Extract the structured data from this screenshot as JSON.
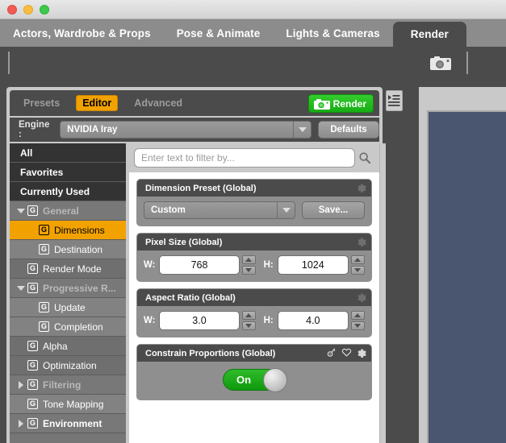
{
  "window": {
    "traffic_lights": [
      "close",
      "minimize",
      "zoom"
    ]
  },
  "main_tabs": [
    {
      "label": "Actors, Wardrobe & Props",
      "active": false
    },
    {
      "label": "Pose & Animate",
      "active": false
    },
    {
      "label": "Lights & Cameras",
      "active": false
    },
    {
      "label": "Render",
      "active": true
    }
  ],
  "toolbar": {
    "camera_icon": "camera-icon"
  },
  "pane": {
    "tabs": [
      {
        "label": "Presets",
        "active": false
      },
      {
        "label": "Editor",
        "active": true
      },
      {
        "label": "Advanced",
        "active": false
      }
    ],
    "render_button": "Render",
    "render_icon": "camera-icon",
    "menu_icon": "pane-options-icon",
    "engine": {
      "label": "Engine :",
      "value": "NVIDIA Iray",
      "defaults_button": "Defaults"
    }
  },
  "sidebar": {
    "items": [
      {
        "label": "All",
        "style": "top",
        "icon": false,
        "twisty": "none",
        "indent": 0
      },
      {
        "label": "Favorites",
        "style": "top",
        "icon": false,
        "twisty": "none",
        "indent": 0
      },
      {
        "label": "Currently Used",
        "style": "top",
        "icon": false,
        "twisty": "none",
        "indent": 0
      },
      {
        "label": "General",
        "style": "group",
        "icon": true,
        "twisty": "down",
        "indent": 0
      },
      {
        "label": "Dimensions",
        "style": "selected",
        "icon": true,
        "twisty": "none",
        "indent": 1
      },
      {
        "label": "Destination",
        "style": "child",
        "icon": true,
        "twisty": "none",
        "indent": 1
      },
      {
        "label": "Render Mode",
        "style": "plain",
        "icon": true,
        "twisty": "none",
        "indent": 0
      },
      {
        "label": "Progressive R...",
        "style": "group",
        "icon": true,
        "twisty": "down",
        "indent": 0
      },
      {
        "label": "Update",
        "style": "child",
        "icon": true,
        "twisty": "none",
        "indent": 1
      },
      {
        "label": "Completion",
        "style": "child",
        "icon": true,
        "twisty": "none",
        "indent": 1
      },
      {
        "label": "Alpha",
        "style": "plain",
        "icon": true,
        "twisty": "none",
        "indent": 0
      },
      {
        "label": "Optimization",
        "style": "plain",
        "icon": true,
        "twisty": "none",
        "indent": 0
      },
      {
        "label": "Filtering",
        "style": "group",
        "icon": true,
        "twisty": "right",
        "indent": 0
      },
      {
        "label": "Tone Mapping",
        "style": "child",
        "icon": true,
        "twisty": "none",
        "indent": 0
      },
      {
        "label": "Environment",
        "style": "env",
        "icon": true,
        "twisty": "right",
        "indent": 0
      }
    ],
    "node_icon_letter": "G"
  },
  "content": {
    "filter_placeholder": "Enter text to filter by...",
    "filter_value": "",
    "search_icon": "magnifier-icon",
    "groups": [
      {
        "title": "Dimension Preset (Global)",
        "type": "preset",
        "header_icons": [
          "gear-icon"
        ],
        "value": "Custom",
        "save_button": "Save..."
      },
      {
        "title": "Pixel Size (Global)",
        "type": "wh",
        "header_icons": [
          "gear-icon"
        ],
        "w_label": "W:",
        "w_value": "768",
        "h_label": "H:",
        "h_value": "1024"
      },
      {
        "title": "Aspect Ratio (Global)",
        "type": "wh",
        "header_icons": [
          "gear-icon"
        ],
        "w_label": "W:",
        "w_value": "3.0",
        "h_label": "H:",
        "h_value": "4.0"
      },
      {
        "title": "Constrain Proportions (Global)",
        "type": "toggle",
        "header_icons": [
          "key-icon",
          "heart-icon",
          "gear-icon"
        ],
        "toggle_state": "On"
      }
    ]
  },
  "right_pane": {
    "viewport_color": "#4a5570"
  },
  "colors": {
    "accent_orange": "#f2a200",
    "render_green": "#17ac14",
    "toggle_green": "#0f9a0d",
    "panel_dark": "#4b4b4b",
    "panel_light": "#c9c9c9",
    "tabstrip": "#8c8c8c"
  }
}
